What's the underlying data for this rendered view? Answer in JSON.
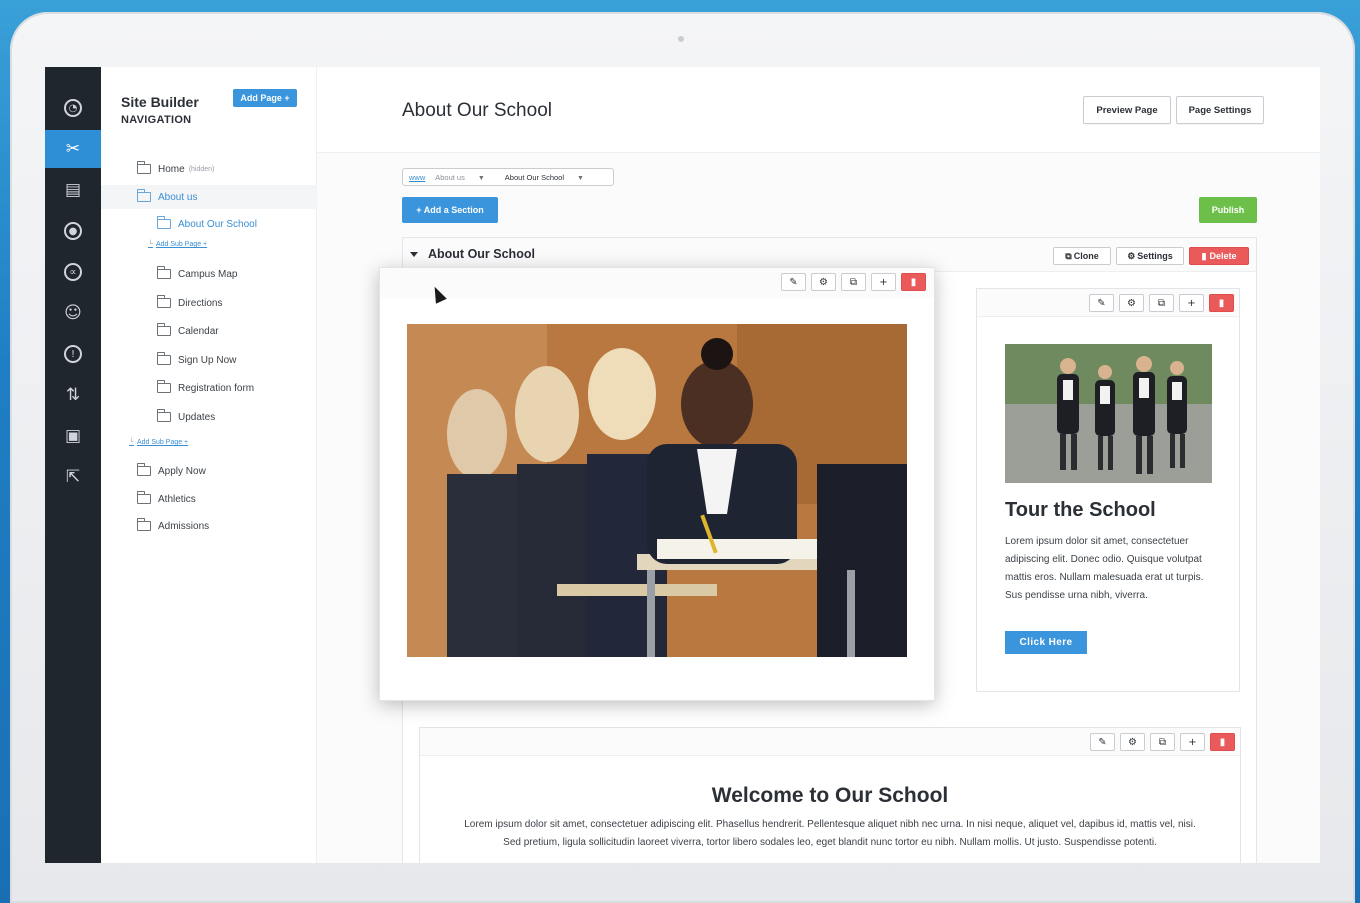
{
  "app": {
    "name": "Site Builder"
  },
  "nav": {
    "title": "Site Builder",
    "subtitle": "NAVIGATION",
    "add_page_label": "Add Page +",
    "items": [
      {
        "label": "Home",
        "tag": "(hidden)"
      },
      {
        "label": "About us"
      },
      {
        "label": "About Our School"
      },
      {
        "label": "Add Sub Page +"
      },
      {
        "label": "Campus Map"
      },
      {
        "label": "Directions"
      },
      {
        "label": "Calendar"
      },
      {
        "label": "Sign Up Now"
      },
      {
        "label": "Registration form"
      },
      {
        "label": "Updates"
      },
      {
        "label": "Add Sub Page +"
      },
      {
        "label": "Apply Now"
      },
      {
        "label": "Athletics"
      },
      {
        "label": "Admissions"
      }
    ]
  },
  "header": {
    "page_title": "About Our School",
    "preview_label": "Preview Page",
    "settings_label": "Page Settings"
  },
  "breadcrumb": {
    "root": "www",
    "parent": "About us",
    "current": "About Our School"
  },
  "actions": {
    "add_section_label": "+ Add a Section",
    "publish_label": "Publish"
  },
  "section": {
    "title": "About Our School",
    "clone_label": "Clone",
    "settings_label": "Settings",
    "delete_label": "Delete"
  },
  "tour_card": {
    "title": "Tour the School",
    "text": "Lorem ipsum dolor sit amet, consectetuer adipiscing elit. Donec odio. Quisque volutpat mattis eros. Nullam malesuada erat ut turpis. Sus pendisse urna nibh, viverra.",
    "button_label": "Click Here"
  },
  "welcome_card": {
    "title": "Welcome to Our School",
    "text": "Lorem ipsum dolor sit amet, consectetuer adipiscing elit. Phasellus hendrerit. Pellentesque aliquet nibh nec urna. In nisi neque, aliquet vel, dapibus id, mattis vel, nisi. Sed pretium, ligula sollicitudin laoreet viverra, tortor libero sodales leo, eget blandit nunc tortor eu nibh. Nullam mollis. Ut justo. Suspendisse potenti."
  },
  "icons": {
    "sidebar": [
      "dashboard-icon",
      "tools-icon",
      "page-icon",
      "user-icon",
      "share-icon",
      "group-icon",
      "alert-icon",
      "sort-icon",
      "code-icon",
      "export-icon"
    ],
    "toolbar": [
      "pencil-icon",
      "gear-icon",
      "copy-icon",
      "plus-icon",
      "trash-icon"
    ]
  },
  "colors": {
    "accent": "#3a95dc",
    "publish": "#6cc04a",
    "danger": "#ea5a5a",
    "sidebar_bg": "#1f262d"
  }
}
